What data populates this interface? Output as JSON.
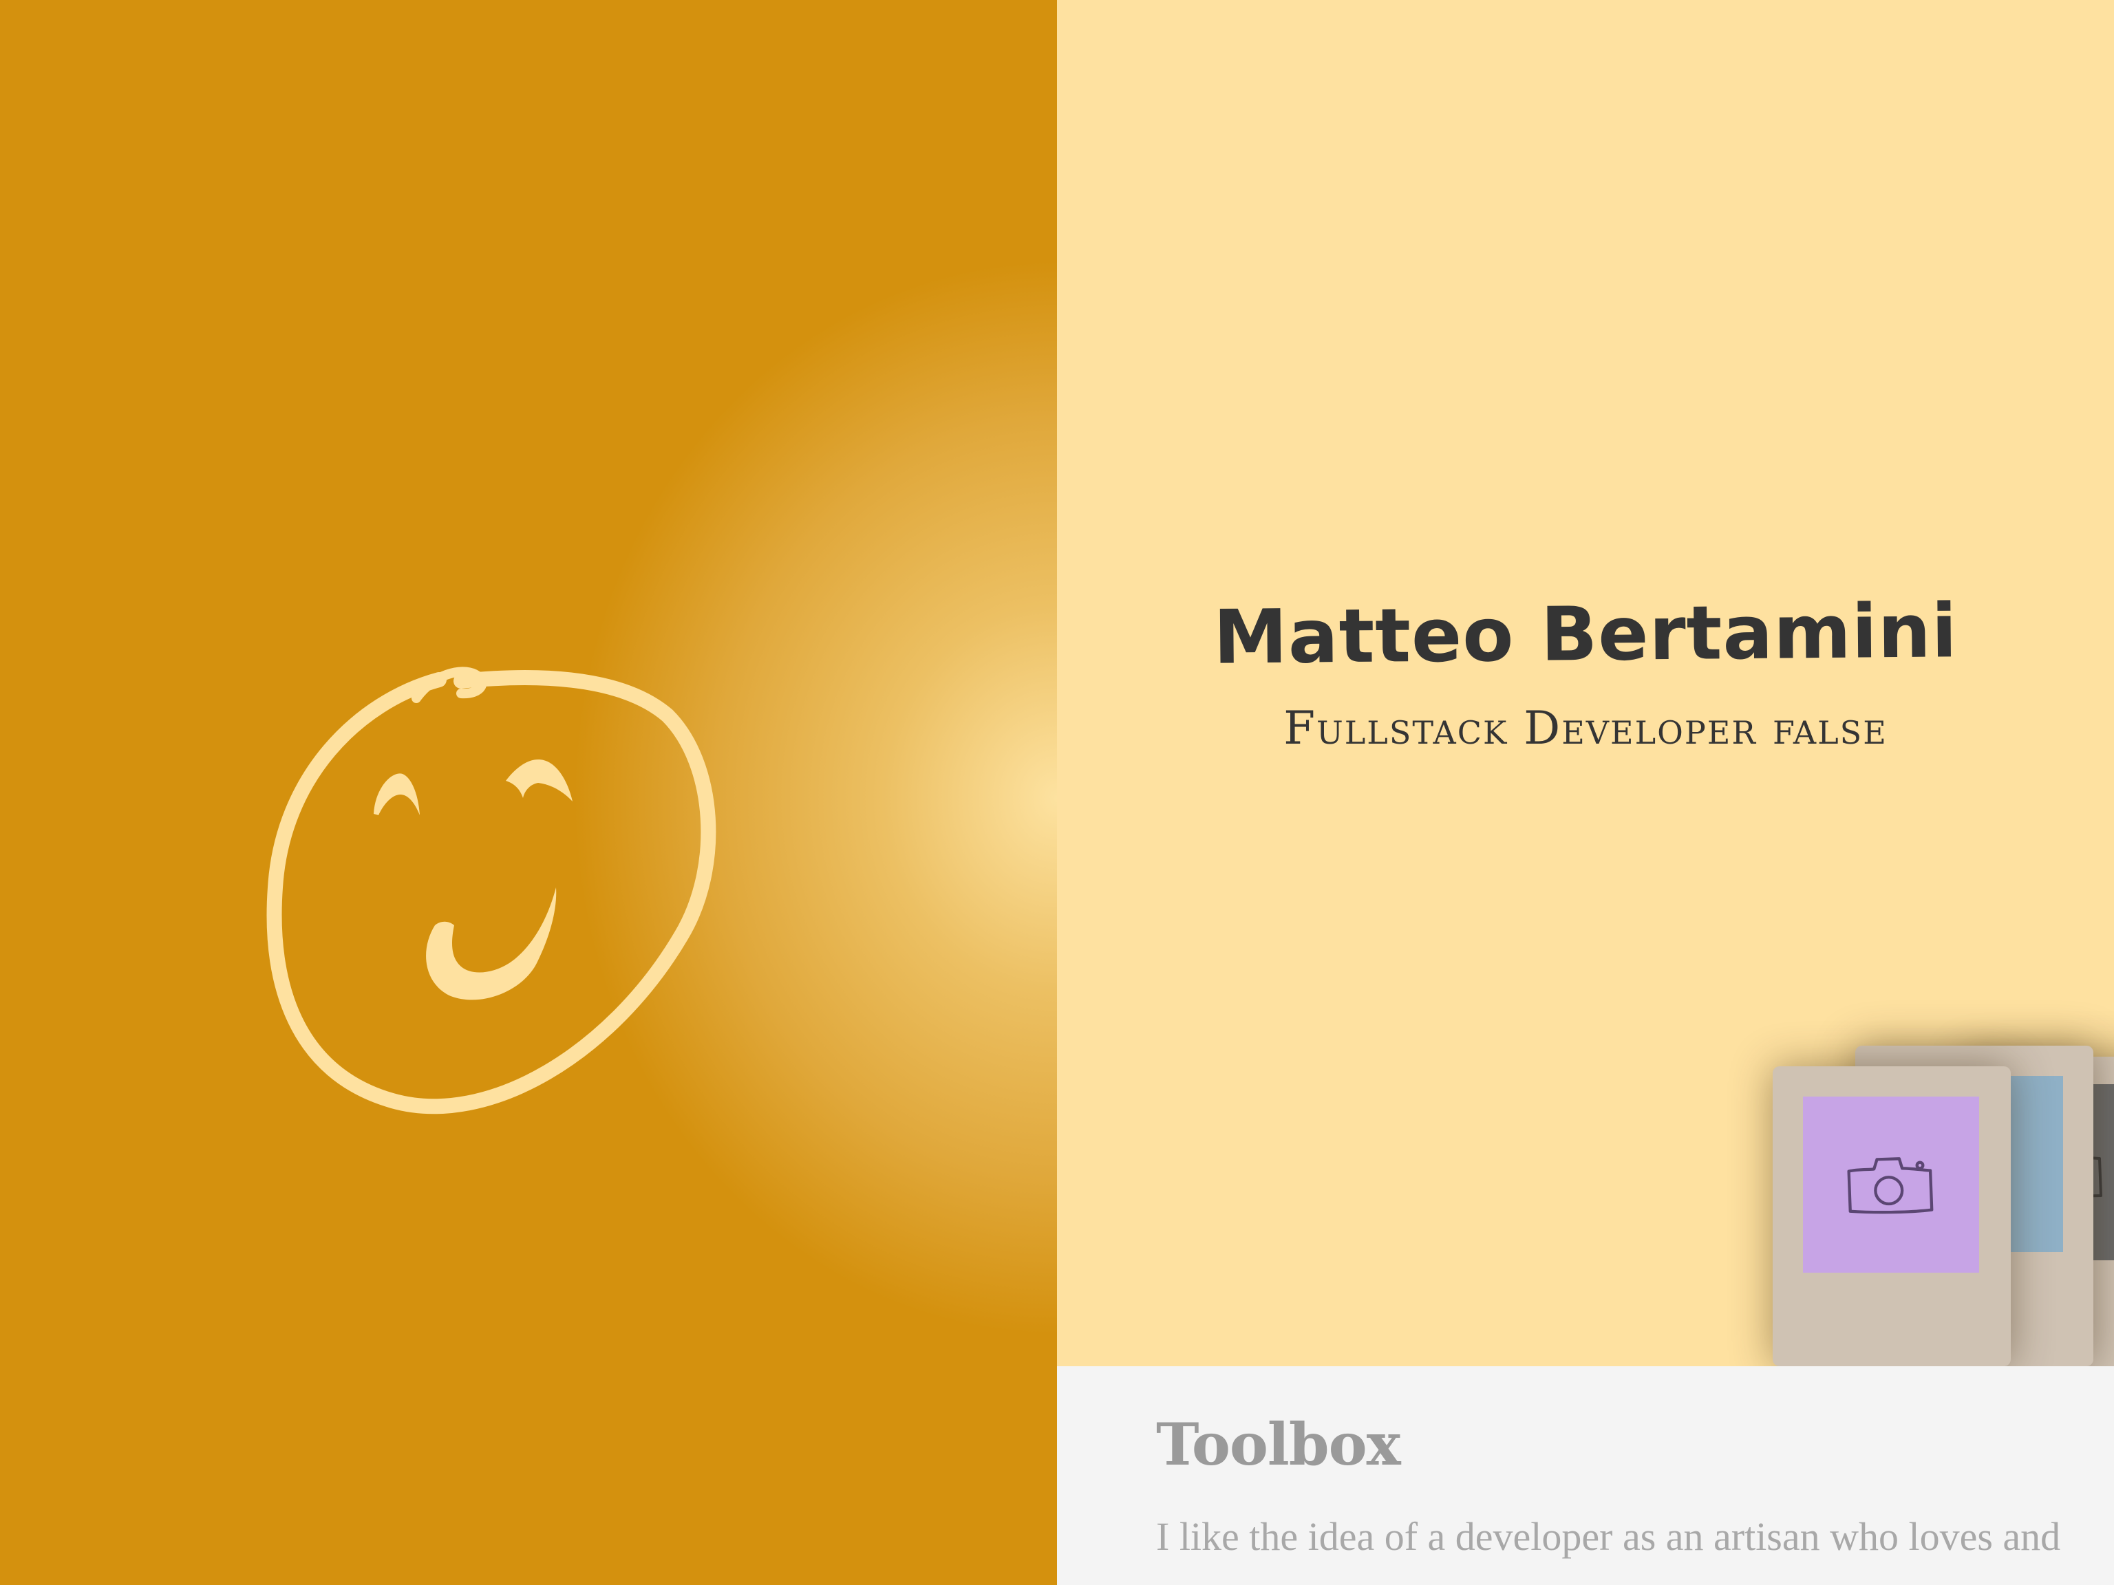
{
  "hero": {
    "name": "Matteo Bertamini",
    "subtitle": "Fullstack Developer false"
  },
  "logo": {
    "icon": "smiley-face-icon"
  },
  "gallery": {
    "icon": "camera-icon",
    "photo_colors": [
      "#c7a4e6",
      "#8fb0c6",
      "#6b6b6b"
    ]
  },
  "toolbox": {
    "title": "Toolbox",
    "text": "I like the idea of a developer as an artisan who loves and"
  },
  "colors": {
    "left_bg": "#d4910e",
    "hero_bg": "#fee1a0",
    "smiley": "#fee1a0",
    "toolbox_bg": "#f4f4f4"
  }
}
